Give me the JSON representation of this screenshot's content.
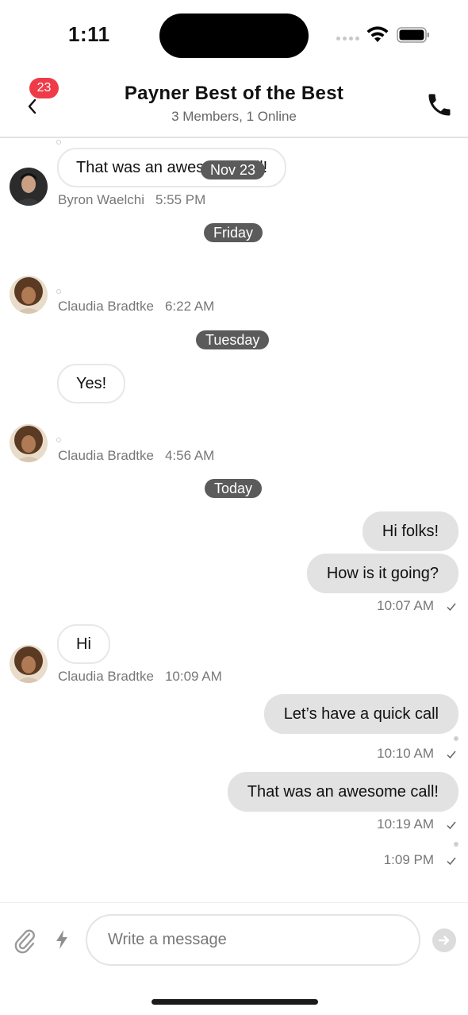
{
  "status_bar": {
    "time": "1:11"
  },
  "header": {
    "back_badge": "23",
    "title": "Payner Best of the Best",
    "subtitle": "3 Members, 1 Online"
  },
  "messages": {
    "m1": {
      "text": "That was an awesome call!",
      "sender": "Byron Waelchi",
      "time": "5:55 PM",
      "overlay_date": "Nov 23"
    },
    "d_friday": "Friday",
    "m2": {
      "sender": "Claudia Bradtke",
      "time": "6:22 AM"
    },
    "d_tuesday": "Tuesday",
    "m3": {
      "text": "Yes!",
      "sender": "Claudia Bradtke",
      "time": "4:56 AM"
    },
    "d_today": "Today",
    "m4": {
      "text": "Hi folks!"
    },
    "m5": {
      "text": "How is it going?",
      "time": "10:07 AM"
    },
    "m6": {
      "text": "Hi",
      "sender": "Claudia Bradtke",
      "time": "10:09 AM"
    },
    "m7": {
      "text": "Let’s have a quick call",
      "time": "10:10 AM"
    },
    "m8": {
      "text": "That was an awesome call!",
      "time": "10:19 AM"
    },
    "m9": {
      "time": "1:09 PM"
    }
  },
  "composer": {
    "placeholder": "Write a message"
  },
  "icons": {
    "back": "chevron-left-icon",
    "call": "phone-icon",
    "attach": "paperclip-icon",
    "quick": "bolt-icon",
    "send": "send-arrow-icon",
    "read": "check-icon"
  },
  "colors": {
    "badge": "#ef3b48",
    "outgoing_bubble": "#e2e2e2",
    "date_pill": "#5b5b5b"
  }
}
